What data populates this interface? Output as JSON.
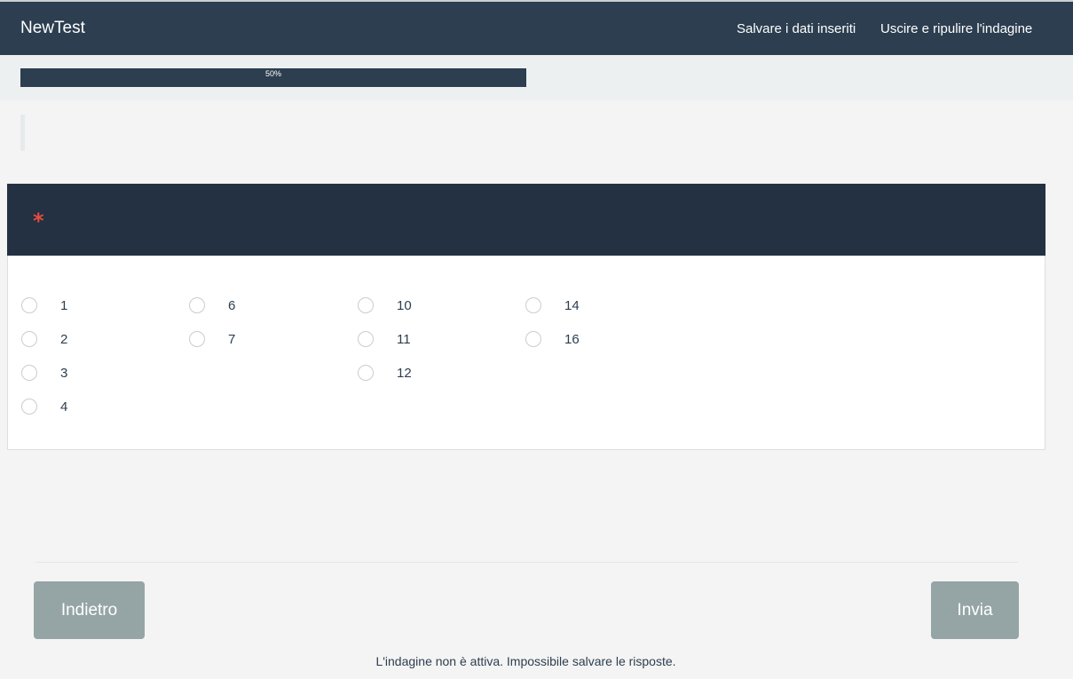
{
  "navbar": {
    "brand": "NewTest",
    "save_label": "Salvare i dati inseriti",
    "exit_label": "Uscire e ripulire l'indagine"
  },
  "progress": {
    "value_percent": 50,
    "label": "50%"
  },
  "question": {
    "required_marker": "*",
    "options": [
      {
        "label": "1",
        "selected": false
      },
      {
        "label": "2",
        "selected": false
      },
      {
        "label": "3",
        "selected": false
      },
      {
        "label": "4",
        "selected": false
      },
      {
        "label": "6",
        "selected": false
      },
      {
        "label": "7",
        "selected": false
      },
      {
        "label": "10",
        "selected": false
      },
      {
        "label": "11",
        "selected": false
      },
      {
        "label": "12",
        "selected": false
      },
      {
        "label": "14",
        "selected": false
      },
      {
        "label": "16",
        "selected": false
      }
    ]
  },
  "footer": {
    "back_label": "Indietro",
    "send_label": "Invia",
    "status_message": "L'indagine non è attiva. Impossibile salvare le risposte."
  }
}
